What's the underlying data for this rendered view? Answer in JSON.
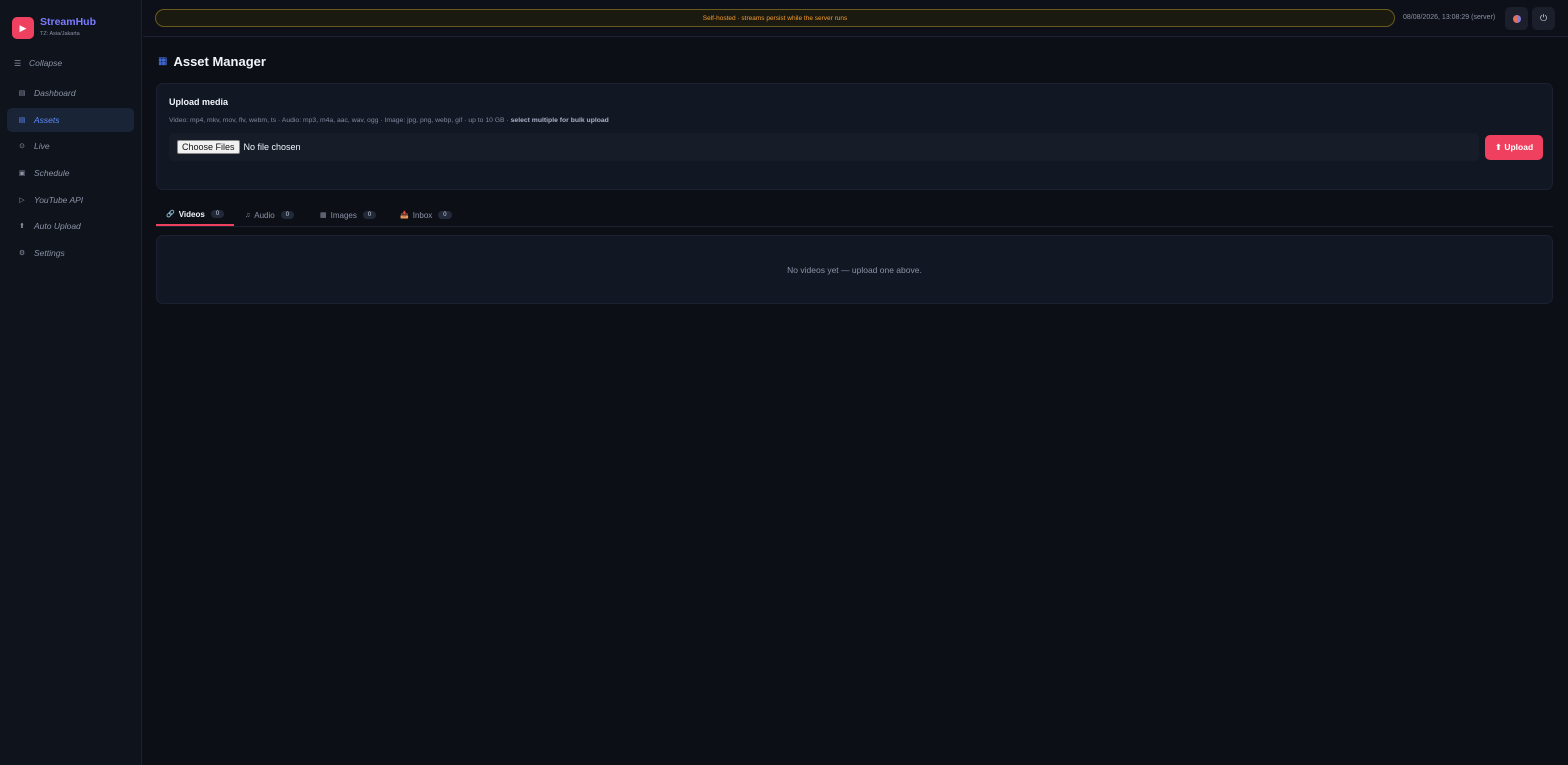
{
  "brand": {
    "name": "StreamHub",
    "timezone": "TZ: Asia/Jakarta",
    "logo_icon": "play-icon"
  },
  "sidebar": {
    "collapse_label": "Collapse",
    "items": [
      {
        "label": "Dashboard",
        "icon": "dashboard-icon",
        "glyph": "▤"
      },
      {
        "label": "Assets",
        "icon": "assets-icon",
        "glyph": "▤",
        "active": true
      },
      {
        "label": "Live",
        "icon": "live-icon",
        "glyph": "⊙"
      },
      {
        "label": "Schedule",
        "icon": "calendar-icon",
        "glyph": "▣"
      },
      {
        "label": "YouTube API",
        "icon": "play-outline-icon",
        "glyph": "▷"
      },
      {
        "label": "Auto Upload",
        "icon": "upload-arrow-icon",
        "glyph": "⬆"
      },
      {
        "label": "Settings",
        "icon": "gear-icon",
        "glyph": "⚙"
      }
    ]
  },
  "topbar": {
    "banner": "Self-hosted · streams persist while the server runs",
    "clock": "08/08/2026, 13:08:29 (server)"
  },
  "page": {
    "title": "Asset Manager"
  },
  "upload": {
    "title": "Upload media",
    "hint": "Video: mp4, mkv, mov, flv, webm, ts · Audio: mp3, m4a, aac, wav, ogg · Image: jpg, png, webp, gif · up to 10 GB · ",
    "hint_bold": "select multiple for bulk upload",
    "choose_label": "Choose Files",
    "file_status": "No file chosen",
    "button_label": "⬆ Upload"
  },
  "tabs": [
    {
      "label": "Videos",
      "count": "0",
      "icon": "link-icon",
      "glyph": "🔗",
      "active": true
    },
    {
      "label": "Audio",
      "count": "0",
      "icon": "music-icon",
      "glyph": "♫"
    },
    {
      "label": "Images",
      "count": "0",
      "icon": "image-icon",
      "glyph": "▦"
    },
    {
      "label": "Inbox",
      "count": "0",
      "icon": "inbox-icon",
      "glyph": "📥"
    }
  ],
  "empty_message": "No videos yet — upload one above.",
  "colors": {
    "accent": "#f0405f",
    "brand": "#7a7cff",
    "active_nav": "#5c8dff",
    "banner_text": "#f29b2e"
  }
}
